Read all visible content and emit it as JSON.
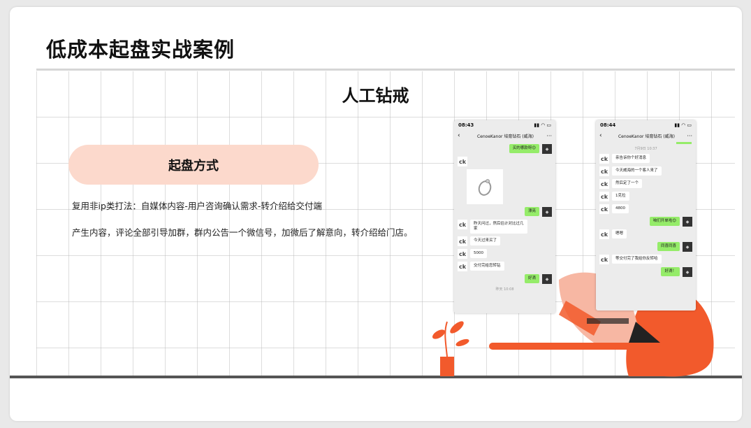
{
  "slide": {
    "title": "低成本起盘实战案例",
    "subtitle": "人工钻戒",
    "pill_label": "起盘方式",
    "paragraph1": "复用非ip类打法：自媒体内容-用户咨询确认需求-转介绍给交付端",
    "paragraph2": "产生内容，评论全部引导加群，群内公告一个微信号，加微后了解意向，转介绍给门店。"
  },
  "phone1": {
    "time": "08:43",
    "status_icons": "▮▮ ◠ ▭",
    "back": "‹",
    "chat_name": "CenoeKanor 培育钻石 (威海)",
    "more": "···",
    "messages": [
      {
        "dir": "out",
        "text": "买的哪款呀😊"
      },
      {
        "dir": "in",
        "type": "image"
      },
      {
        "dir": "out",
        "text": "漂亮"
      },
      {
        "dir": "in",
        "text": "昨天问过，然后估计对比过几家"
      },
      {
        "dir": "in",
        "text": "今天过来买了"
      },
      {
        "dir": "in",
        "text": "5000"
      },
      {
        "dir": "in",
        "text": "交付完给您转钻"
      },
      {
        "dir": "out",
        "text": "好滴"
      }
    ],
    "footer_time": "昨天 10:08"
  },
  "phone2": {
    "time": "08:44",
    "status_icons": "▮▮ ◠ ▭",
    "back": "‹",
    "chat_name": "CenoeKanor 培育钻石 (威海)",
    "more": "···",
    "top_time": "7月9日 10:37",
    "messages": [
      {
        "dir": "in",
        "text": "亲告诉你个好消息"
      },
      {
        "dir": "in",
        "text": "今天威海的一个客人来了"
      },
      {
        "dir": "in",
        "text": "然后定了一个"
      },
      {
        "dir": "in",
        "text": "1克拉"
      },
      {
        "dir": "in",
        "text": "4800"
      },
      {
        "dir": "out",
        "text": "咱们开单啦😊"
      },
      {
        "dir": "in",
        "text": "嗯嗯"
      },
      {
        "dir": "out",
        "text": "同喜同喜"
      },
      {
        "dir": "in",
        "text": "等交付完了我给你反转哈"
      },
      {
        "dir": "out",
        "text": "好滴！"
      }
    ]
  },
  "avatar_text": {
    "ck": "ck",
    "me": "◆"
  },
  "colors": {
    "accent_orange": "#f25a2c",
    "pill_bg": "#fcd9cc",
    "wechat_green": "#95ec69"
  }
}
